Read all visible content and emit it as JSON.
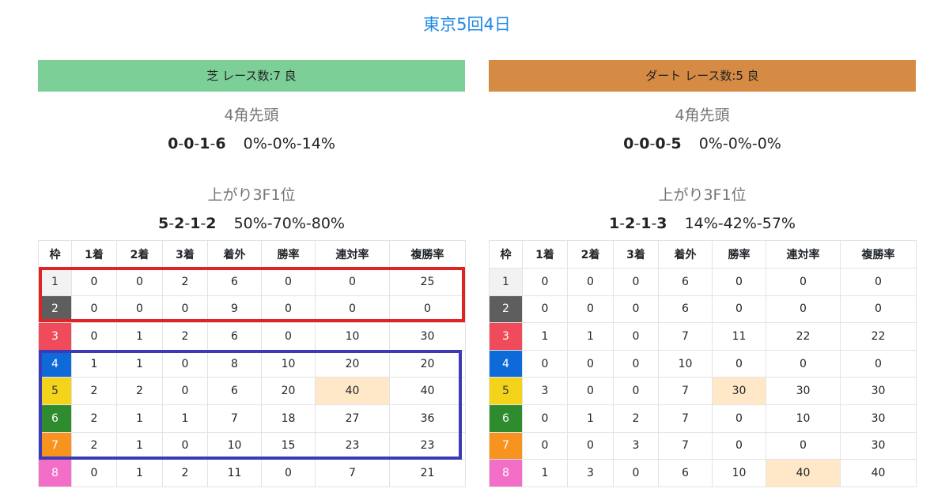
{
  "page_title": "東京5回4日",
  "colors": {
    "turf_bar": "#7dcf98",
    "dirt_bar": "#d68b45",
    "highlight_cell": "#ffe8c8",
    "annotation_red": "#e02424",
    "annotation_blue": "#3b3bb8"
  },
  "turf": {
    "header": "芝 レース数:7  良",
    "corner_label": "4角先頭",
    "corner_record": [
      "0",
      "0",
      "1",
      "6"
    ],
    "corner_rates": "0%-0%-14%",
    "last3f_label": "上がり3F1位",
    "last3f_record": [
      "5",
      "2",
      "1",
      "2"
    ],
    "last3f_rates": "50%-70%-80%",
    "columns": [
      "枠",
      "1着",
      "2着",
      "3着",
      "着外",
      "勝率",
      "連対率",
      "複勝率"
    ],
    "rows": [
      [
        "1",
        "0",
        "0",
        "2",
        "6",
        "0",
        "0",
        "25"
      ],
      [
        "2",
        "0",
        "0",
        "0",
        "9",
        "0",
        "0",
        "0"
      ],
      [
        "3",
        "0",
        "1",
        "2",
        "6",
        "0",
        "10",
        "30"
      ],
      [
        "4",
        "1",
        "1",
        "0",
        "8",
        "10",
        "20",
        "20"
      ],
      [
        "5",
        "2",
        "2",
        "0",
        "6",
        "20",
        "40",
        "40"
      ],
      [
        "6",
        "2",
        "1",
        "1",
        "7",
        "18",
        "27",
        "36"
      ],
      [
        "7",
        "2",
        "1",
        "0",
        "10",
        "15",
        "23",
        "23"
      ],
      [
        "8",
        "0",
        "1",
        "2",
        "11",
        "0",
        "7",
        "21"
      ]
    ],
    "highlight": {
      "row": 4,
      "col": 6
    }
  },
  "dirt": {
    "header": "ダート レース数:5  良",
    "corner_label": "4角先頭",
    "corner_record": [
      "0",
      "0",
      "0",
      "5"
    ],
    "corner_rates": "0%-0%-0%",
    "last3f_label": "上がり3F1位",
    "last3f_record": [
      "1",
      "2",
      "1",
      "3"
    ],
    "last3f_rates": "14%-42%-57%",
    "columns": [
      "枠",
      "1着",
      "2着",
      "3着",
      "着外",
      "勝率",
      "連対率",
      "複勝率"
    ],
    "rows": [
      [
        "1",
        "0",
        "0",
        "0",
        "6",
        "0",
        "0",
        "0"
      ],
      [
        "2",
        "0",
        "0",
        "0",
        "6",
        "0",
        "0",
        "0"
      ],
      [
        "3",
        "1",
        "1",
        "0",
        "7",
        "11",
        "22",
        "22"
      ],
      [
        "4",
        "0",
        "0",
        "0",
        "10",
        "0",
        "0",
        "0"
      ],
      [
        "5",
        "3",
        "0",
        "0",
        "7",
        "30",
        "30",
        "30"
      ],
      [
        "6",
        "0",
        "1",
        "2",
        "7",
        "0",
        "10",
        "30"
      ],
      [
        "7",
        "0",
        "0",
        "3",
        "7",
        "0",
        "0",
        "30"
      ],
      [
        "8",
        "1",
        "3",
        "0",
        "6",
        "10",
        "40",
        "40"
      ]
    ],
    "highlights": [
      {
        "row": 4,
        "col": 5
      },
      {
        "row": 7,
        "col": 6
      }
    ]
  }
}
